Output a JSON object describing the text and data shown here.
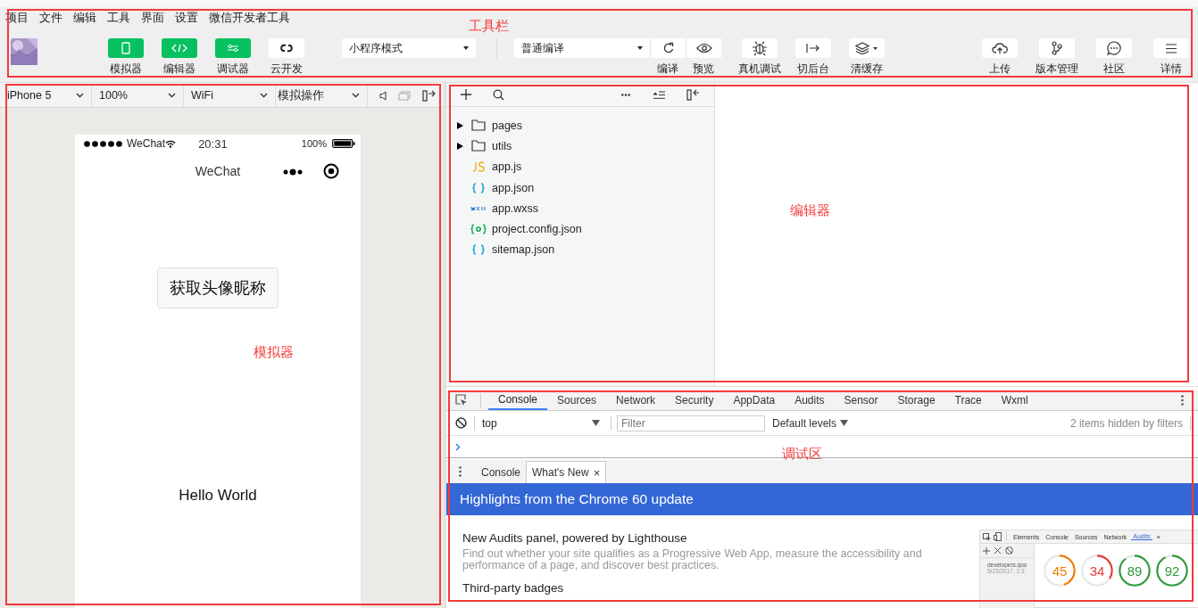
{
  "menu": [
    "项目",
    "文件",
    "编辑",
    "工具",
    "界面",
    "设置",
    "微信开发者工具"
  ],
  "view_buttons": [
    {
      "label": "模拟器",
      "selected": true
    },
    {
      "label": "编辑器",
      "selected": true
    },
    {
      "label": "调试器",
      "selected": true
    },
    {
      "label": "云开发",
      "selected": false
    }
  ],
  "mode_select": {
    "value": "小程序模式"
  },
  "compile_select": {
    "value": "普通编译"
  },
  "compile_actions": [
    {
      "label": "编译"
    },
    {
      "label": "预览"
    }
  ],
  "actions": [
    {
      "label": "真机调试"
    },
    {
      "label": "切后台"
    },
    {
      "label": "清缓存"
    }
  ],
  "right_actions": [
    {
      "label": "上传"
    },
    {
      "label": "版本管理"
    },
    {
      "label": "社区"
    },
    {
      "label": "详情"
    }
  ],
  "device_bar": [
    {
      "value": "iPhone 5"
    },
    {
      "value": "100%"
    },
    {
      "value": "WiFi"
    },
    {
      "value": "模拟操作"
    }
  ],
  "phone": {
    "carrier": "WeChat",
    "time": "20:31",
    "battery": "100%",
    "nav_title": "WeChat",
    "button": "获取头像昵称",
    "text": "Hello World"
  },
  "file_tree": [
    {
      "name": "pages",
      "kind": "folder",
      "expanded": false
    },
    {
      "name": "utils",
      "kind": "folder",
      "expanded": false
    },
    {
      "name": "app.js",
      "kind": "js"
    },
    {
      "name": "app.json",
      "kind": "json"
    },
    {
      "name": "app.wxss",
      "kind": "wxss"
    },
    {
      "name": "project.config.json",
      "kind": "config"
    },
    {
      "name": "sitemap.json",
      "kind": "json"
    }
  ],
  "devtools": {
    "tabs": [
      {
        "label": "Console",
        "selected": true
      },
      {
        "label": "Sources",
        "selected": false
      },
      {
        "label": "Network",
        "selected": false
      },
      {
        "label": "Security",
        "selected": false
      },
      {
        "label": "AppData",
        "selected": false
      },
      {
        "label": "Audits",
        "selected": false
      },
      {
        "label": "Sensor",
        "selected": false
      },
      {
        "label": "Storage",
        "selected": false
      },
      {
        "label": "Trace",
        "selected": false
      },
      {
        "label": "Wxml",
        "selected": false
      }
    ],
    "context": "top",
    "filter_placeholder": "Filter",
    "levels": "Default levels",
    "hidden_note": "2 items hidden by filters",
    "drawer_tabs": [
      {
        "label": "Console",
        "selected": false,
        "closable": false
      },
      {
        "label": "What's New",
        "selected": true,
        "closable": true
      }
    ],
    "close_glyph": "×",
    "banner": "Highlights from the Chrome 60 update",
    "articles": [
      {
        "title": "New Audits panel, powered by Lighthouse",
        "body": "Find out whether your site qualifies as a Progressive Web App, measure the accessibility and performance of a page, and discover best practices."
      },
      {
        "title": "Third-party badges"
      }
    ],
    "inset": {
      "tabs": [
        {
          "label": "Elements",
          "selected": false
        },
        {
          "label": "Console",
          "selected": false
        },
        {
          "label": "Sources",
          "selected": false
        },
        {
          "label": "Network",
          "selected": false
        },
        {
          "label": "Audits",
          "selected": true
        },
        {
          "label": "»",
          "selected": false
        }
      ],
      "site": "developers.goo",
      "date": "5/23/2017, 2:3",
      "scores": [
        {
          "value": "45",
          "color": "#f57c00"
        },
        {
          "value": "34",
          "color": "#e53935"
        },
        {
          "value": "89",
          "color": "#2e9b3a"
        },
        {
          "value": "92",
          "color": "#2e9b3a"
        }
      ]
    }
  },
  "annotations": [
    "工具栏",
    "模拟器",
    "编辑器",
    "调试区"
  ]
}
